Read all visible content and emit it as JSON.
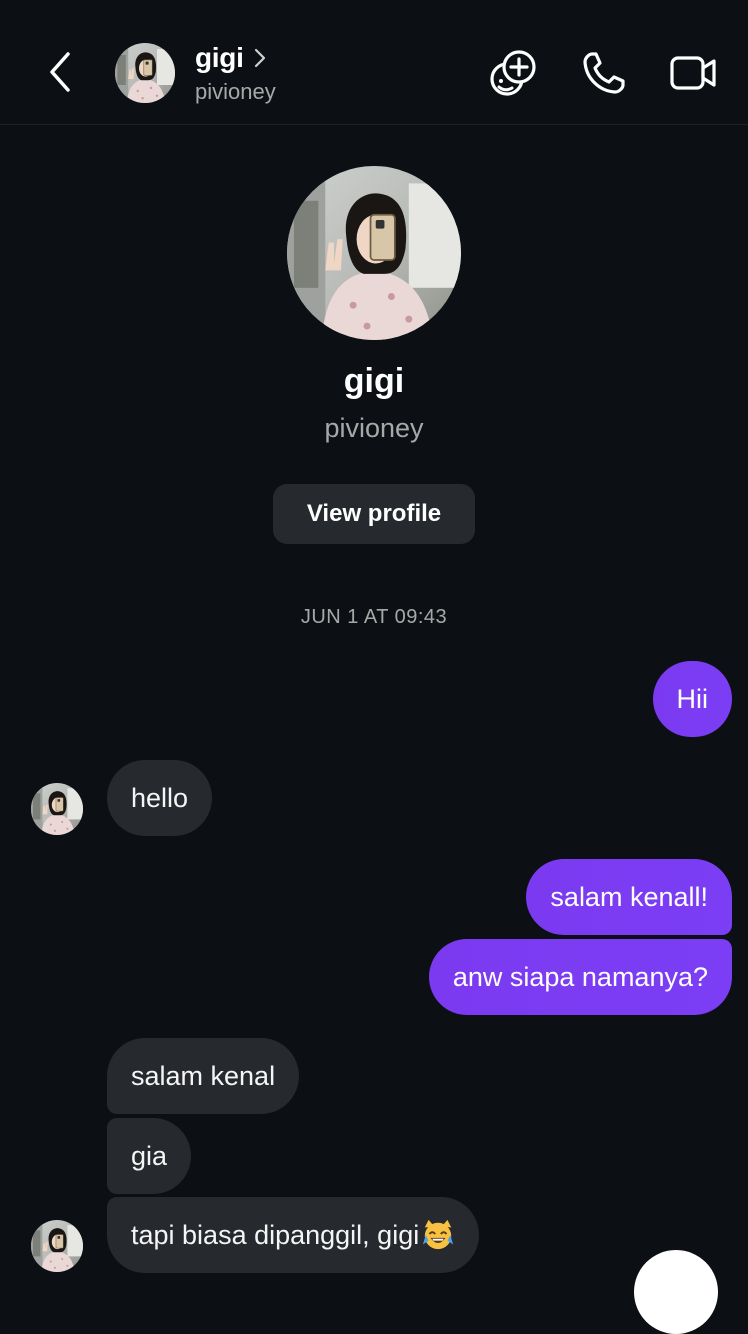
{
  "header": {
    "display_name": "gigi",
    "username": "pivioney"
  },
  "profile": {
    "display_name": "gigi",
    "username": "pivioney",
    "view_profile_label": "View profile"
  },
  "conversation": {
    "timestamp": "JUN 1 AT 09:43",
    "messages": [
      {
        "direction": "sent",
        "text": "Hii"
      },
      {
        "direction": "received",
        "text": "hello"
      },
      {
        "direction": "sent",
        "text": "salam kenall!"
      },
      {
        "direction": "sent",
        "text": "anw siapa namanya?"
      },
      {
        "direction": "received",
        "text": "salam kenal"
      },
      {
        "direction": "received",
        "text": "gia"
      },
      {
        "direction": "received",
        "text": "tapi biasa dipanggil, gigi"
      }
    ]
  },
  "icons": {
    "back": "chevron-left-icon",
    "profile_chevron": "chevron-right-icon",
    "effects": "effects-icon",
    "call": "phone-icon",
    "video": "video-camera-icon",
    "emoji": "laughing-cat-emoji"
  },
  "colors": {
    "background": "#0c1014",
    "sent_bubble": "#7b3af0",
    "received_bubble": "#262a2f",
    "secondary_text": "#a8a8a8"
  }
}
